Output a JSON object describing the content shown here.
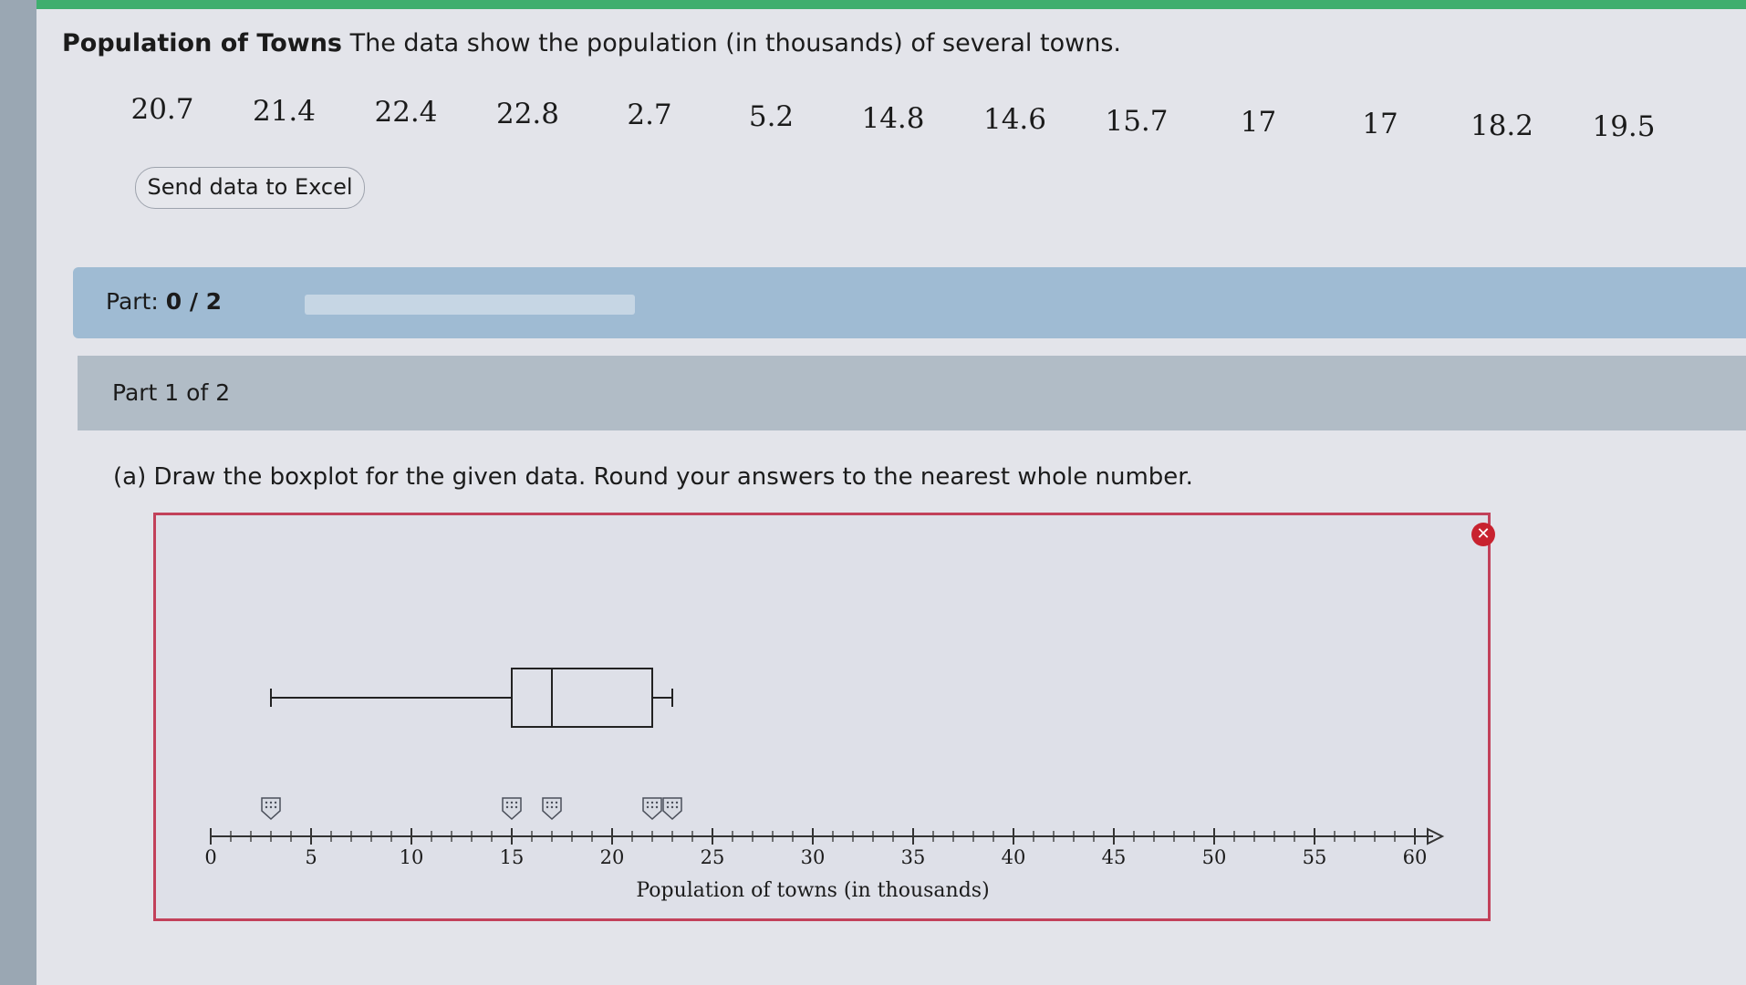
{
  "problem": {
    "title_bold": "Population of Towns",
    "title_rest": " The data show the population (in thousands) of several towns."
  },
  "data_values": [
    "20.7",
    "21.4",
    "22.4",
    "22.8",
    "2.7",
    "5.2",
    "14.8",
    "14.6",
    "15.7",
    "17",
    "17",
    "18.2",
    "19.5"
  ],
  "excel_button": "Send data to Excel",
  "progress": {
    "label_prefix": "Part: ",
    "label_value": "0 / 2",
    "fraction": 0
  },
  "part_header": "Part 1 of 2",
  "question": "(a) Draw the boxplot for the given data. Round your answers to the nearest whole number.",
  "colors": {
    "frame_border": "#c2415a",
    "close_badge": "#c8222f",
    "progress_fill": "#4a79b0"
  },
  "chart_data": {
    "type": "boxplot",
    "xlabel": "Population of towns (in thousands)",
    "xlim": [
      0,
      60
    ],
    "major_ticks": [
      0,
      5,
      10,
      15,
      20,
      25,
      30,
      35,
      40,
      45,
      50,
      55,
      60
    ],
    "minor_tick_step": 1,
    "boxplot": {
      "min": 3,
      "q1": 15,
      "median": 17,
      "q3": 22,
      "max": 23
    },
    "handles_icon": "draggable-handle-icon"
  }
}
